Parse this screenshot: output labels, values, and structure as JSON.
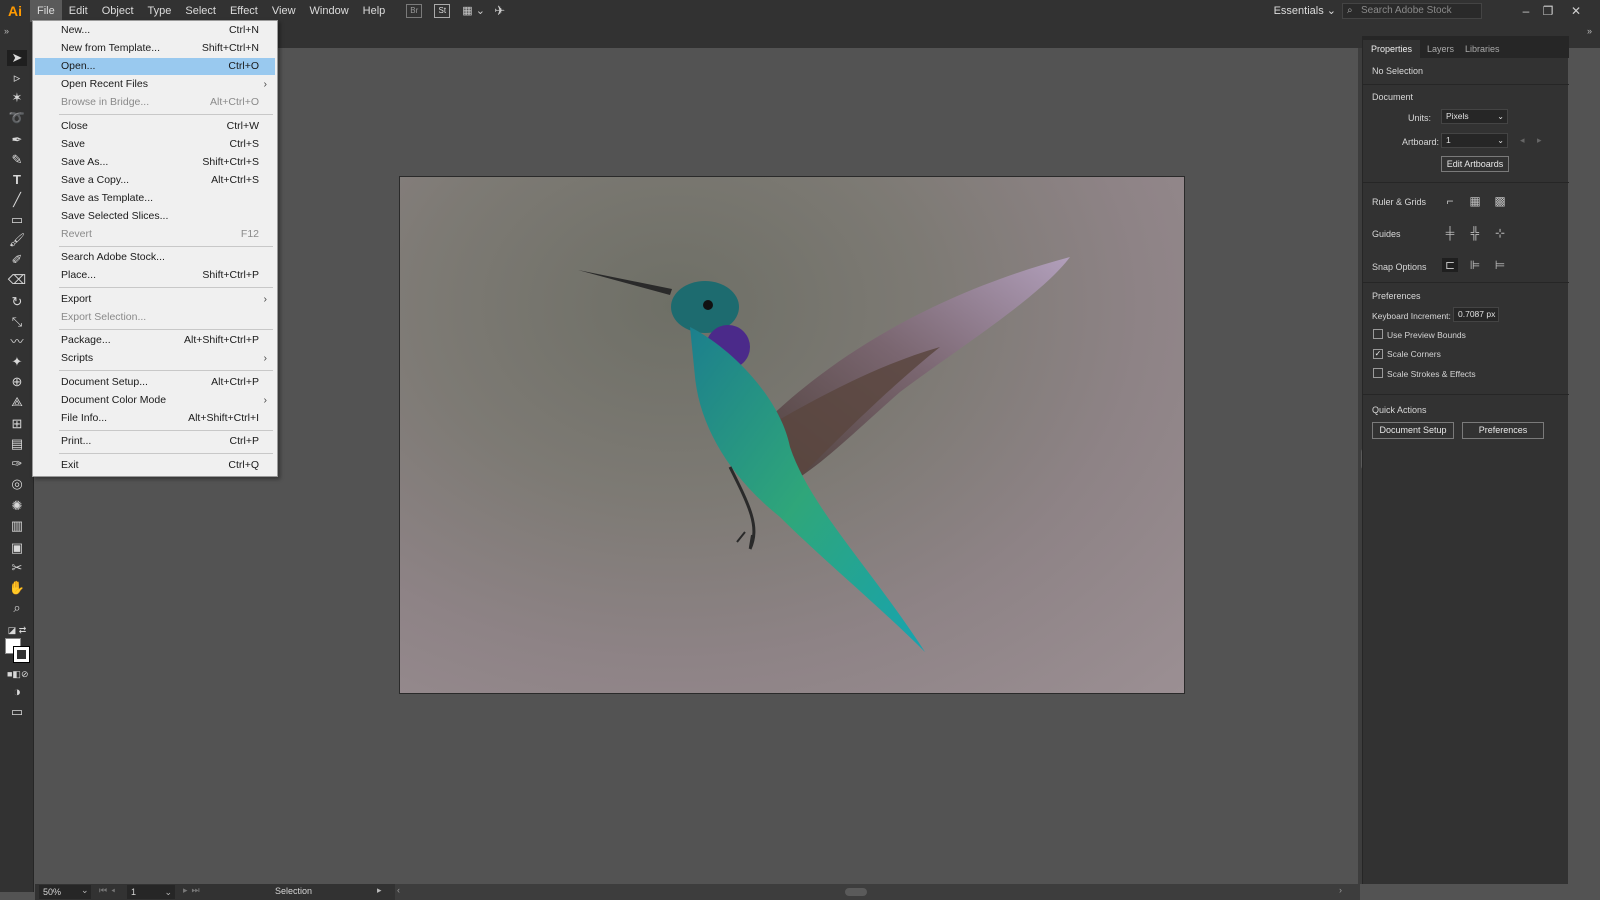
{
  "app": {
    "logo": "Ai"
  },
  "menubar": {
    "items": [
      "File",
      "Edit",
      "Object",
      "Type",
      "Select",
      "Effect",
      "View",
      "Window",
      "Help"
    ],
    "icon_br": "Br",
    "icon_st": "St",
    "workspace": "Essentials",
    "workspace_caret": "⌄",
    "search_placeholder": "Search Adobe Stock",
    "win_min": "–",
    "win_max": "❐",
    "win_close": "✕"
  },
  "file_menu": {
    "items": [
      {
        "label": "New...",
        "shortcut": "Ctrl+N"
      },
      {
        "label": "New from Template...",
        "shortcut": "Shift+Ctrl+N"
      },
      {
        "label": "Open...",
        "shortcut": "Ctrl+O"
      },
      {
        "label": "Open Recent Files",
        "shortcut": "›"
      },
      {
        "label": "Browse in Bridge...",
        "shortcut": "Alt+Ctrl+O"
      },
      {
        "label": "Close",
        "shortcut": "Ctrl+W"
      },
      {
        "label": "Save",
        "shortcut": "Ctrl+S"
      },
      {
        "label": "Save As...",
        "shortcut": "Shift+Ctrl+S"
      },
      {
        "label": "Save a Copy...",
        "shortcut": "Alt+Ctrl+S"
      },
      {
        "label": "Save as Template...",
        "shortcut": ""
      },
      {
        "label": "Save Selected Slices...",
        "shortcut": ""
      },
      {
        "label": "Revert",
        "shortcut": "F12"
      },
      {
        "label": "Search Adobe Stock...",
        "shortcut": ""
      },
      {
        "label": "Place...",
        "shortcut": "Shift+Ctrl+P"
      },
      {
        "label": "Export",
        "shortcut": "›"
      },
      {
        "label": "Export Selection...",
        "shortcut": ""
      },
      {
        "label": "Package...",
        "shortcut": "Alt+Shift+Ctrl+P"
      },
      {
        "label": "Scripts",
        "shortcut": "›"
      },
      {
        "label": "Document Setup...",
        "shortcut": "Alt+Ctrl+P"
      },
      {
        "label": "Document Color Mode",
        "shortcut": "›"
      },
      {
        "label": "File Info...",
        "shortcut": "Alt+Shift+Ctrl+I"
      },
      {
        "label": "Print...",
        "shortcut": "Ctrl+P"
      },
      {
        "label": "Exit",
        "shortcut": "Ctrl+Q"
      }
    ]
  },
  "properties_panel": {
    "tabs": [
      "Properties",
      "Layers",
      "Libraries"
    ],
    "selection": "No Selection",
    "document_header": "Document",
    "units_label": "Units:",
    "units_value": "Pixels",
    "artboard_label": "Artboard:",
    "artboard_value": "1",
    "edit_artboards": "Edit Artboards",
    "ruler_grids": "Ruler & Grids",
    "guides": "Guides",
    "snap_options": "Snap Options",
    "preferences_header": "Preferences",
    "keyboard_increment_label": "Keyboard Increment:",
    "keyboard_increment_value": "0.7087 px",
    "use_preview_bounds": "Use Preview Bounds",
    "scale_corners": "Scale Corners",
    "scale_strokes": "Scale Strokes & Effects",
    "checkbox_states": {
      "use_preview_bounds": false,
      "scale_corners": true,
      "scale_strokes": false
    },
    "quick_actions": "Quick Actions",
    "document_setup_btn": "Document Setup",
    "preferences_btn": "Preferences"
  },
  "statusbar": {
    "zoom": "50%",
    "artboard_num": "1",
    "tool_status": "Selection"
  },
  "colors": {
    "app_bg": "#535353",
    "panel_bg": "#323232",
    "menu_highlight": "#99c9ef",
    "logo": "#ff9a00"
  }
}
